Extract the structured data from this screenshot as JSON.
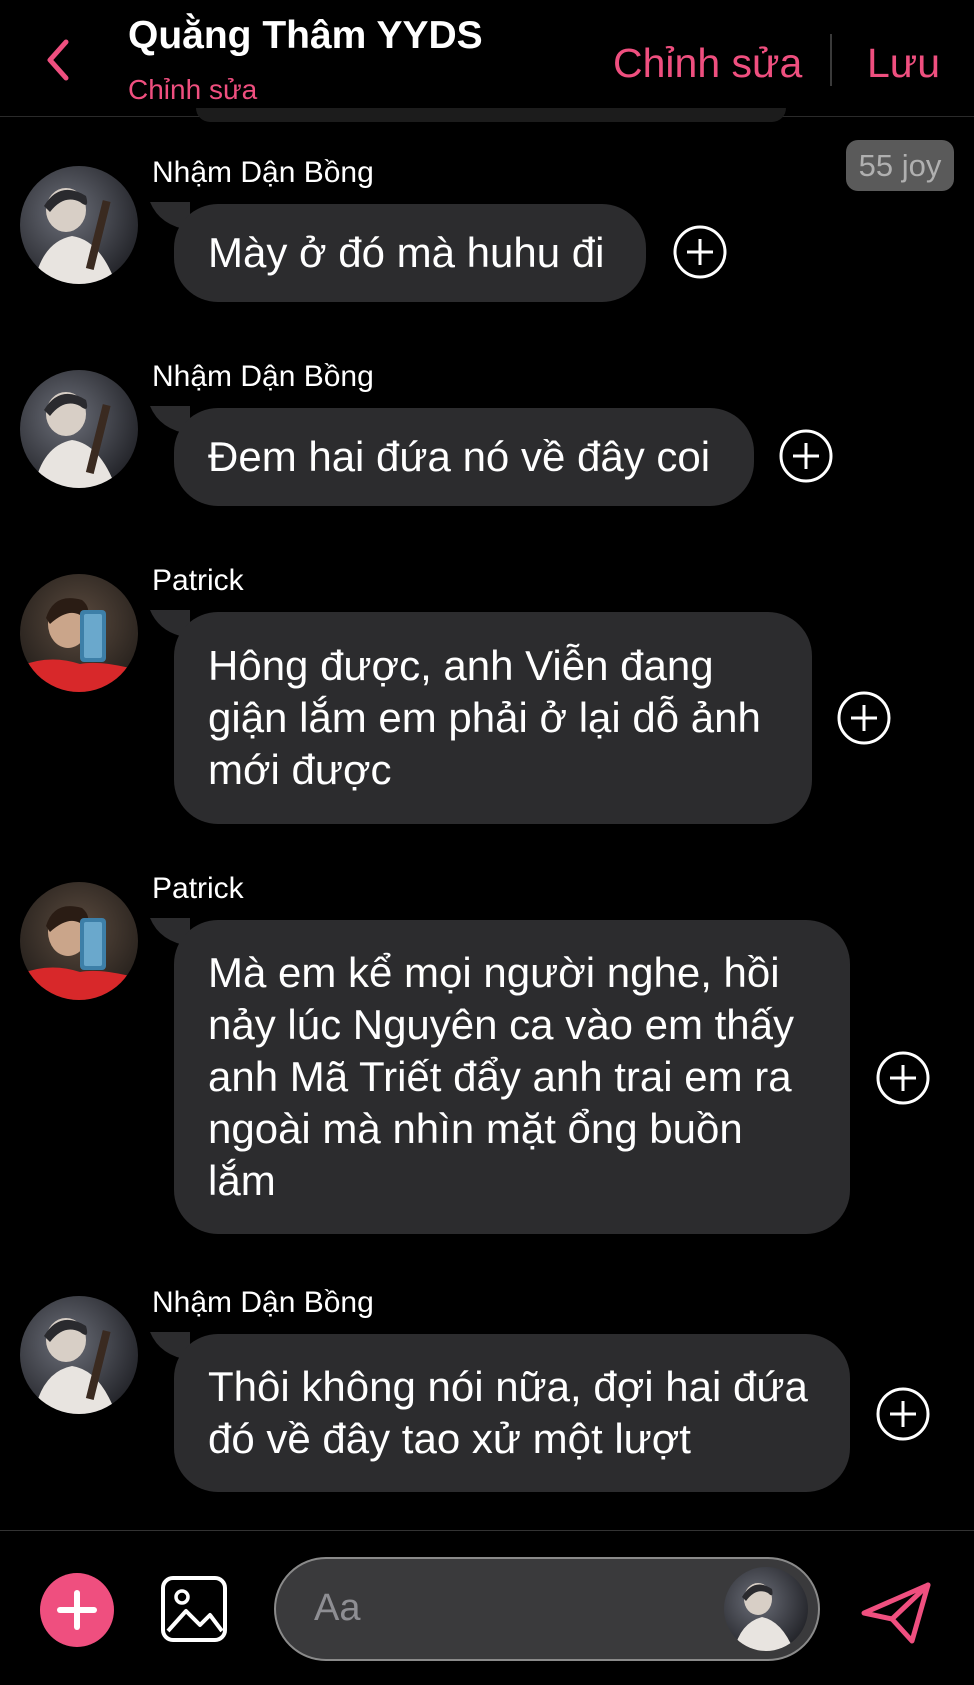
{
  "header": {
    "title": "Quằng Thâm YYDS",
    "subtitle": "Chỉnh sửa",
    "edit_label": "Chỉnh sửa",
    "save_label": "Lưu"
  },
  "badge": "55 joy",
  "messages": [
    {
      "sender": "Nhậm Dận Bồng",
      "lines": [
        "Mày ở đó mà huhu đi"
      ]
    },
    {
      "sender": "Nhậm Dận Bồng",
      "lines": [
        "Đem hai đứa nó về đây coi"
      ]
    },
    {
      "sender": "Patrick",
      "lines": [
        "Hông được, anh Viễn đang",
        "giận lắm em phải ở lại dỗ ảnh",
        "mới được"
      ]
    },
    {
      "sender": "Patrick",
      "lines": [
        "Mà em kể mọi người nghe, hồi",
        "nảy lúc Nguyên ca vào em thấy",
        "anh Mã Triết đẩy anh trai em ra",
        "ngoài mà nhìn mặt ổng buồn",
        "lắm"
      ]
    },
    {
      "sender": "Nhậm Dận Bồng",
      "lines": [
        "Thôi không nói nữa, đợi hai đứa",
        "đó về đây tao xử một lượt"
      ]
    }
  ],
  "composer": {
    "placeholder": "Aa"
  },
  "colors": {
    "accent": "#ef4f7f",
    "bubble": "#2c2c2e",
    "background": "#000000"
  },
  "icons": {
    "back": "chevron-left-icon",
    "add": "plus-icon",
    "image": "image-icon",
    "send": "send-icon",
    "react": "add-reaction-icon"
  }
}
